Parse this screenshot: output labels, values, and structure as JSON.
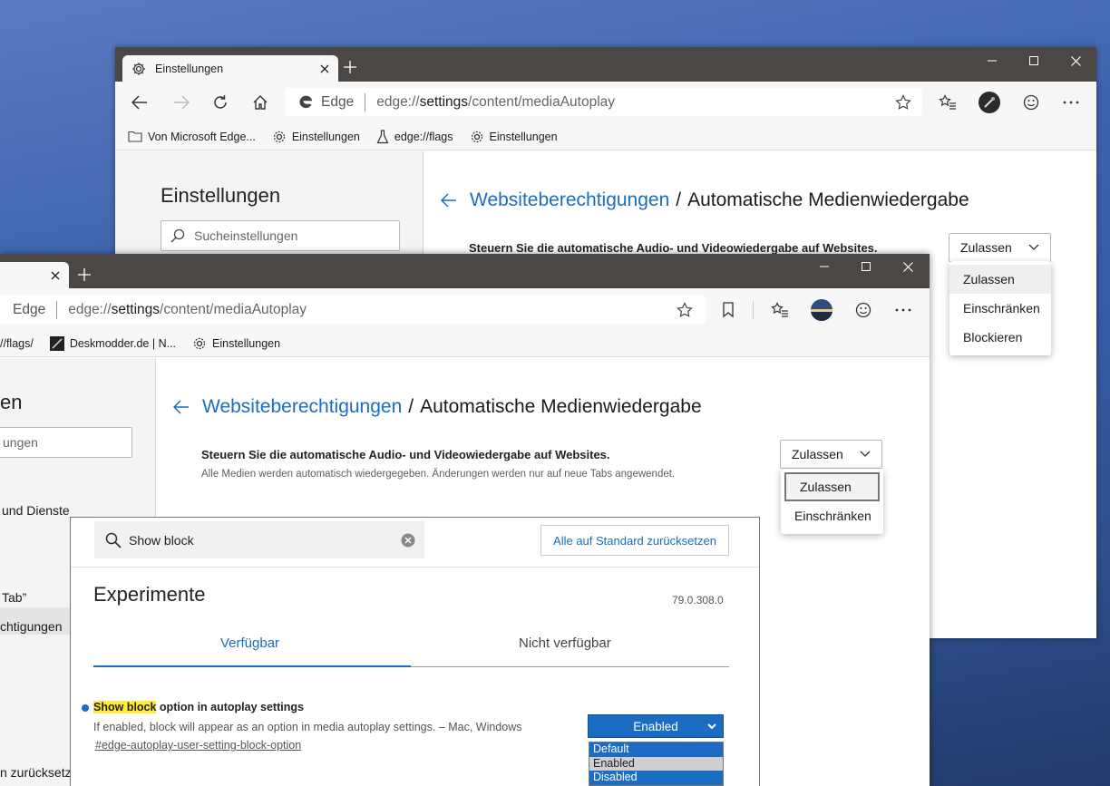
{
  "back_window": {
    "tab_title": "Einstellungen",
    "address": {
      "brand": "Edge",
      "url_prefix": "edge://",
      "url_host": "settings",
      "url_path": "/content/mediaAutoplay"
    },
    "favorites": [
      {
        "icon": "folder-icon",
        "label": "Von Microsoft Edge..."
      },
      {
        "icon": "gear-icon",
        "label": "Einstellungen"
      },
      {
        "icon": "flask-icon",
        "label": "edge://flags"
      },
      {
        "icon": "gear-icon",
        "label": "Einstellungen"
      }
    ],
    "sidebar": {
      "title": "Einstellungen",
      "search_placeholder": "Sucheinstellungen"
    },
    "breadcrumb": {
      "link": "Websiteberechtigungen",
      "separator": "/",
      "current": "Automatische Medienwiedergabe"
    },
    "setting_label": "Steuern Sie die automatische Audio- und Videowiedergabe auf Websites.",
    "dropdown": {
      "selected": "Zulassen",
      "options": [
        "Zulassen",
        "Einschränken",
        "Blockieren"
      ]
    }
  },
  "front_window": {
    "address": {
      "brand": "Edge",
      "url_prefix": "edge://",
      "url_host": "settings",
      "url_path": "/content/mediaAutoplay"
    },
    "favorites": [
      {
        "icon": "flask-icon",
        "label": "//flags/"
      },
      {
        "icon": "deskmodder-icon",
        "label": "Deskmodder.de | N..."
      },
      {
        "icon": "gear-icon",
        "label": "Einstellungen"
      }
    ],
    "sidebar": {
      "title_fragment": "en",
      "search_fragment": "ungen",
      "items": [
        "und Dienste",
        "Tab”",
        "chtigungen",
        "n zurücksetzen"
      ]
    },
    "breadcrumb": {
      "link": "Websiteberechtigungen",
      "separator": "/",
      "current": "Automatische Medienwiedergabe"
    },
    "setting_label": "Steuern Sie die automatische Audio- und Videowiedergabe auf Websites.",
    "setting_desc": "Alle Medien werden automatisch wiedergegeben. Änderungen werden nur auf neue Tabs angewendet.",
    "dropdown": {
      "selected": "Zulassen",
      "options": [
        "Zulassen",
        "Einschränken"
      ]
    }
  },
  "flags_window": {
    "search_value": "Show block",
    "reset_label": "Alle auf Standard zurücksetzen",
    "title": "Experimente",
    "version": "79.0.308.0",
    "tabs": [
      "Verfügbar",
      "Nicht verfügbar"
    ],
    "flag": {
      "name_highlight": "Show block",
      "name_rest": " option in autoplay settings",
      "description": "If enabled, block will appear as an option in media autoplay settings. – Mac, Windows",
      "link": "#edge-autoplay-user-setting-block-option",
      "selected": "Enabled",
      "options": [
        "Default",
        "Enabled",
        "Disabled"
      ]
    }
  },
  "colors": {
    "accent": "#1a6dc2",
    "titlebar": "#4a4744",
    "highlight": "#ffeb3b"
  }
}
